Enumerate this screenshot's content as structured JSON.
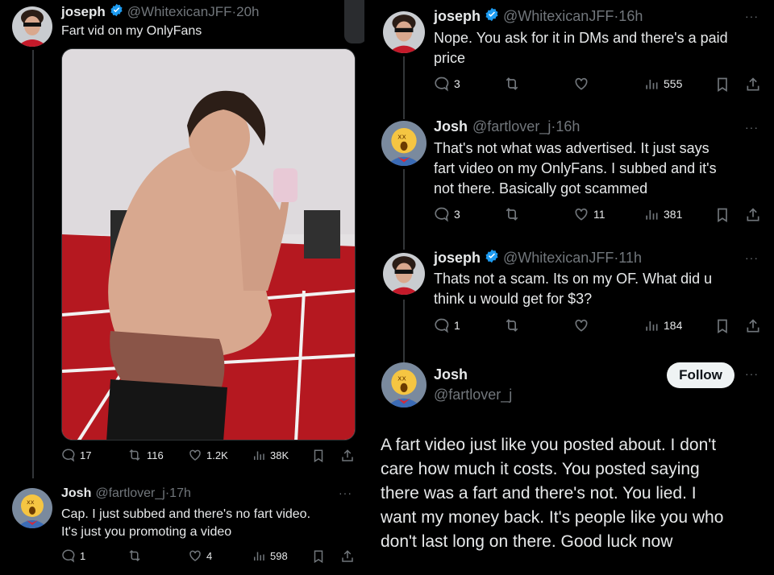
{
  "left": {
    "tweet1": {
      "name": "joseph",
      "handle": "@WhitexicanJFF",
      "time": "·20h",
      "text": "Fart vid on my OnlyFans",
      "replies": "17",
      "retweets": "116",
      "likes": "1.2K",
      "views": "38K"
    },
    "tweet2": {
      "name": "Josh",
      "handle": "@fartlover_j",
      "time": "·17h",
      "text_line1": "Cap. I just subbed and there's no fart video.",
      "text_line2": "It's just you promoting a video",
      "replies": "1",
      "retweets": "",
      "likes": "4",
      "views": "598"
    }
  },
  "right": {
    "tweet1": {
      "name": "joseph",
      "handle": "@WhitexicanJFF",
      "time": "·16h",
      "text_line1": "Nope. You ask for it in DMs and there's a paid",
      "text_line2": "price",
      "replies": "3",
      "likes": "",
      "views": "555"
    },
    "tweet2": {
      "name": "Josh",
      "handle": "@fartlover_j",
      "time": "·16h",
      "text_line1": "That's not what was advertised. It just says",
      "text_line2": "fart video on my OnlyFans. I subbed and it's",
      "text_line3": "not there. Basically got scammed",
      "replies": "3",
      "likes": "11",
      "views": "381"
    },
    "tweet3": {
      "name": "joseph",
      "handle": "@WhitexicanJFF",
      "time": "·11h",
      "text_line1": "Thats not a scam. Its on my OF. What did u",
      "text_line2": "think u would get for $3?",
      "replies": "1",
      "likes": "",
      "views": "184"
    },
    "tweet4": {
      "name": "Josh",
      "handle": "@fartlover_j",
      "follow_label": "Follow",
      "text_lines": [
        "A fart video just like you posted about. I don't",
        "care how much it costs. You posted saying",
        "there was a fart and there's not. You lied. I",
        "want my money back. It's people like you who",
        "don't last long on there. Good luck now"
      ]
    }
  },
  "colors": {
    "background": "#000000",
    "text": "#e7e9ea",
    "muted": "#71767b",
    "verified": "#1d9bf0"
  }
}
